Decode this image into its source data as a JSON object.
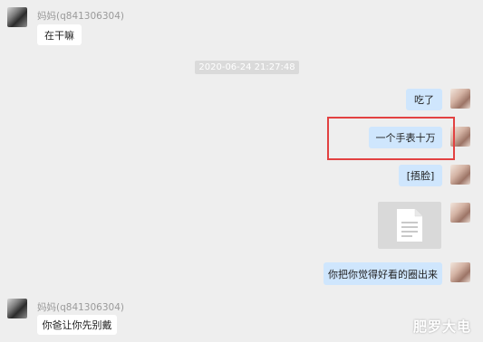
{
  "contacts": {
    "mom_name": "妈妈(q841306304)",
    "me_avatar_icon": "user-avatar-icon",
    "mom_avatar_icon": "contact-avatar-icon"
  },
  "messages": [
    {
      "from": "mom",
      "text": "在干嘛"
    },
    {
      "from": "me",
      "text": "吃了"
    },
    {
      "from": "me",
      "text": "一个手表十万"
    },
    {
      "from": "me",
      "text": "[捂脸]"
    },
    {
      "from": "me",
      "type": "file",
      "icon": "document-file-icon"
    },
    {
      "from": "me",
      "text": "你把你觉得好看的圈出来"
    },
    {
      "from": "mom",
      "text": "你爸让你先别戴"
    }
  ],
  "timestamp": "2020-06-24 21:27:48",
  "watermark": "肥罗大电",
  "colors": {
    "highlight": "#e24141",
    "my_bubble": "#cfe6fd",
    "their_bubble": "#ffffff"
  }
}
